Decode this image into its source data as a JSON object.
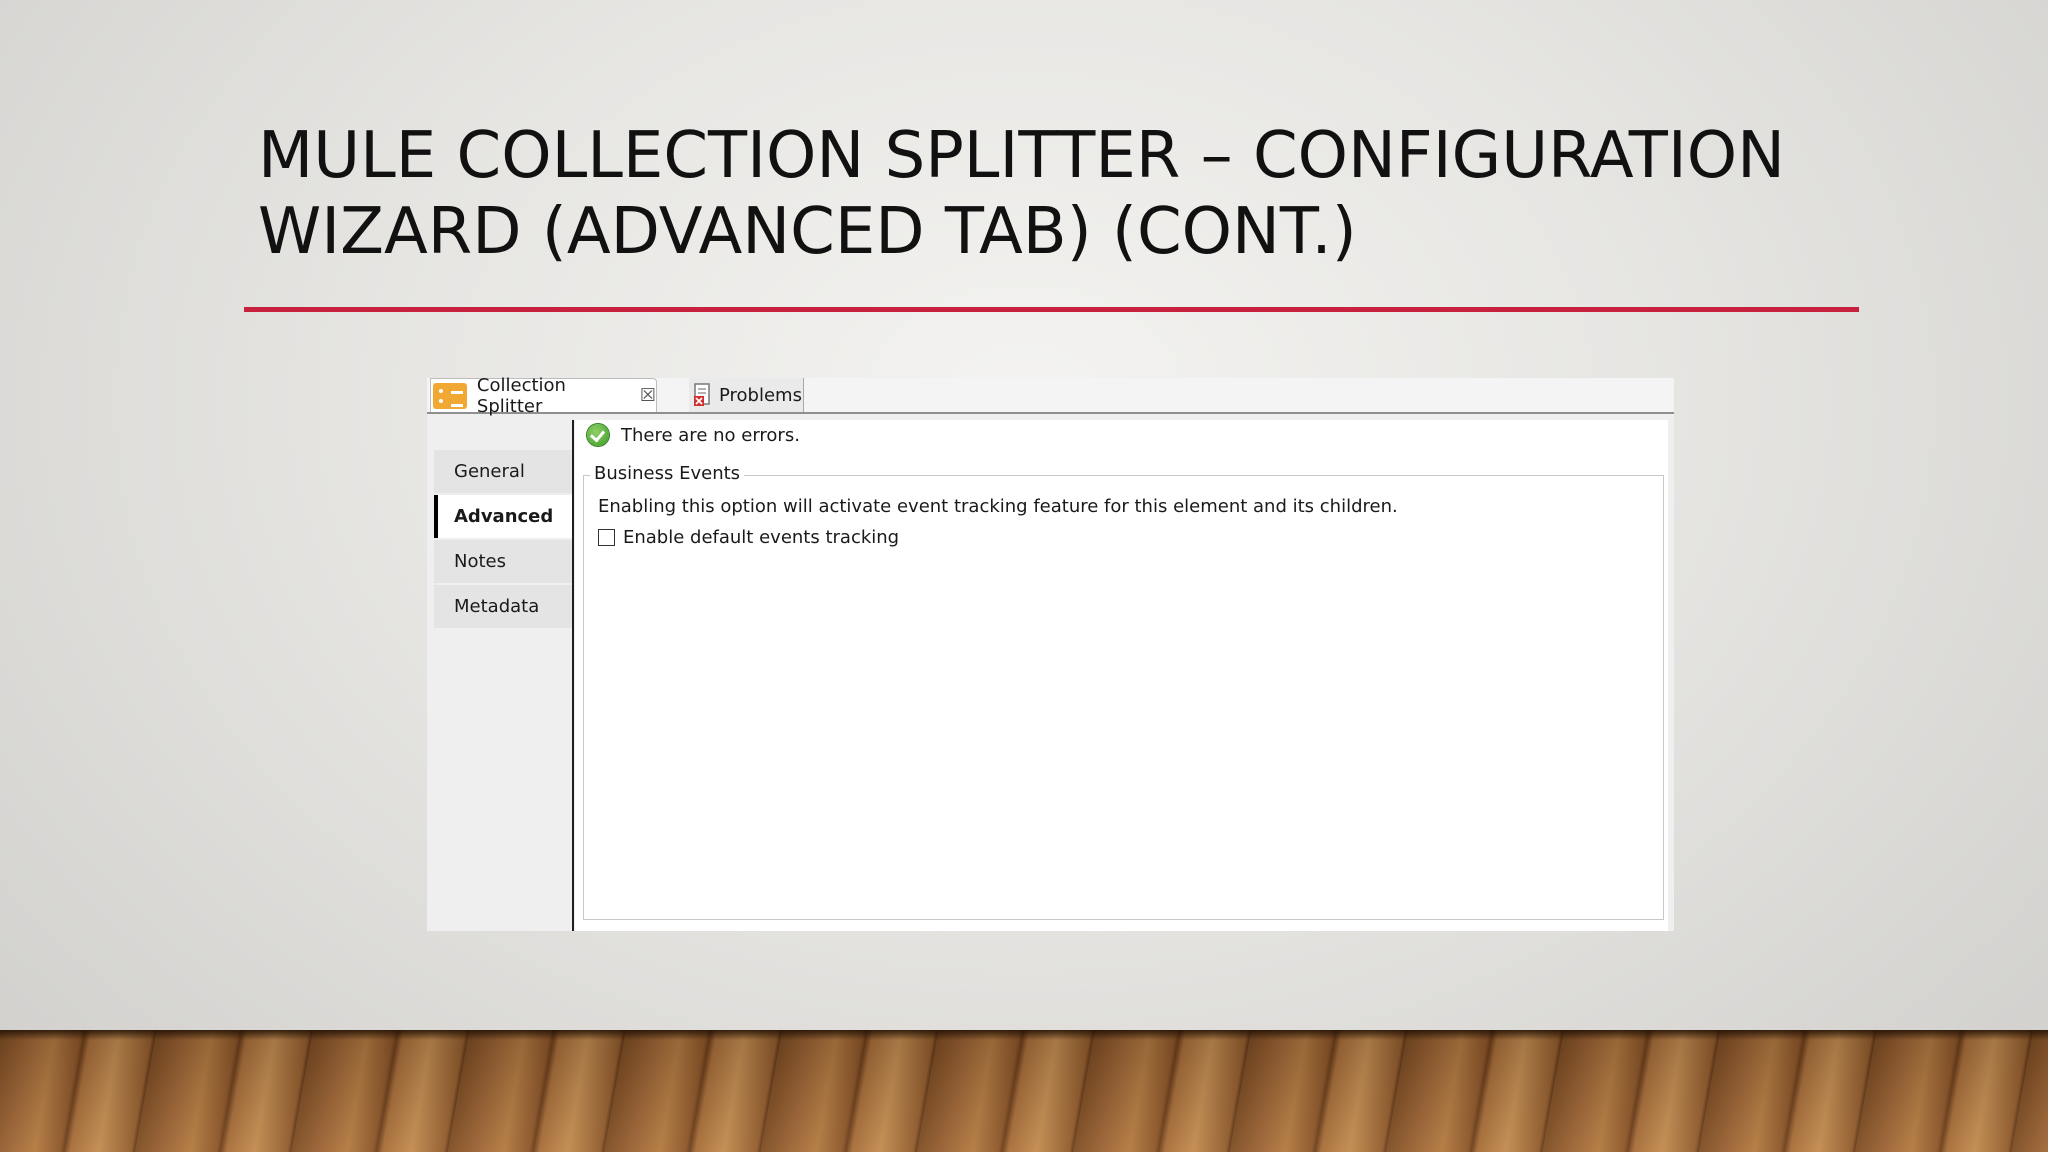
{
  "slide": {
    "title_line1": "MULE COLLECTION SPLITTER – CONFIGURATION",
    "title_line2": "WIZARD (ADVANCED TAB) (CONT.)",
    "accent_color": "#c7213e"
  },
  "editor": {
    "tabs": [
      {
        "label": "Collection Splitter",
        "icon": "collection-splitter-icon",
        "active": true
      },
      {
        "label": "Problems",
        "icon": "problems-icon",
        "active": false
      }
    ],
    "sidebar": {
      "items": [
        {
          "label": "General",
          "active": false
        },
        {
          "label": "Advanced",
          "active": true
        },
        {
          "label": "Notes",
          "active": false
        },
        {
          "label": "Metadata",
          "active": false
        }
      ]
    },
    "status": {
      "icon": "ok-check-icon",
      "text": "There are no errors."
    },
    "business_events": {
      "legend": "Business Events",
      "description": "Enabling this option will activate event tracking feature for this element and its children.",
      "checkbox_label": "Enable default events tracking",
      "checked": false
    }
  }
}
